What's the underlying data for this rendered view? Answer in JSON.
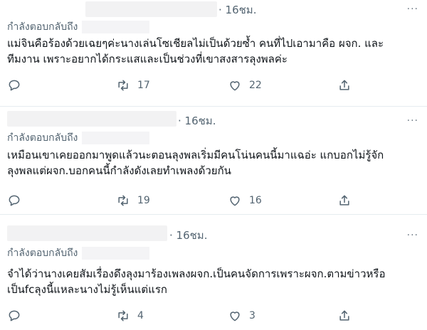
{
  "tweets": [
    {
      "time": "· 16ชม.",
      "more": "···",
      "reply_label": "กำลังตอบกลับถึง",
      "text_lines": [
        "แม่จินคือร้องด้วยเฉยๆค่ะนางเล่นโซเชียลไม่เป็นด้วยซ้ำ คนที่ไปเอามาคือ ผจก. และ",
        "ทีมงาน เพราะอยากได้กระแสและเป็นช่วงที่เขาสงสารลุงพลค่ะ"
      ],
      "retweets": "17",
      "likes": "22"
    },
    {
      "time": "· 16ชม.",
      "more": "···",
      "reply_label": "กำลังตอบกลับถึง",
      "text_lines": [
        "เหมือนเขาเคยออกมาพูดแล้วนะตอนลุงพลเริ่มมีคนโน่นคนนี้มาแฉอ่ะ แกบอกไม่รู้จัก",
        "ลุงพลแต่ผจก.บอกคนนี้กำลังดังเลยทำเพลงด้วยกัน"
      ],
      "retweets": "19",
      "likes": "16"
    },
    {
      "time": "· 16ชม.",
      "more": "···",
      "reply_label": "กำลังตอบกลับถึง",
      "text_lines": [
        "จำได้ว่านางเคยสัมเรื่องดึงลุงมาร้องเพลงผจก.เป็นคนจัดการเพราะผจก.ตามข่าวหรือ",
        "เป็นfcลุงนี้แหละนางไม่รู้เห็นแต่แรก"
      ],
      "retweets": "4",
      "likes": "3"
    }
  ],
  "icons": {
    "reply": "reply-icon",
    "retweet": "retweet-icon",
    "like": "like-icon",
    "share": "share-icon"
  },
  "colors": {
    "text": "#0f1419",
    "muted": "#536471",
    "divider": "#e6ecf0",
    "mask": "#f2f2f3"
  }
}
